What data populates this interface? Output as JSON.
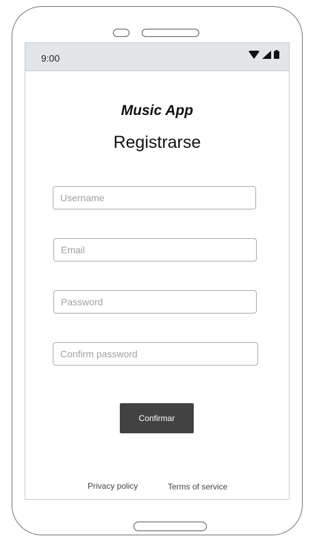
{
  "status_bar": {
    "time": "9:00",
    "icons": [
      "wifi-icon",
      "signal-icon",
      "battery-icon"
    ]
  },
  "header": {
    "app_title": "Music App",
    "page_title": "Registrarse"
  },
  "form": {
    "username_placeholder": "Username",
    "email_placeholder": "Email",
    "password_placeholder": "Password",
    "confirm_password_placeholder": "Confirm password",
    "submit_label": "Confirmar"
  },
  "footer": {
    "privacy_label": "Privacy policy",
    "terms_label": "Terms of service"
  },
  "colors": {
    "button_bg": "#424242",
    "status_bar_bg": "#e3e6e8"
  }
}
